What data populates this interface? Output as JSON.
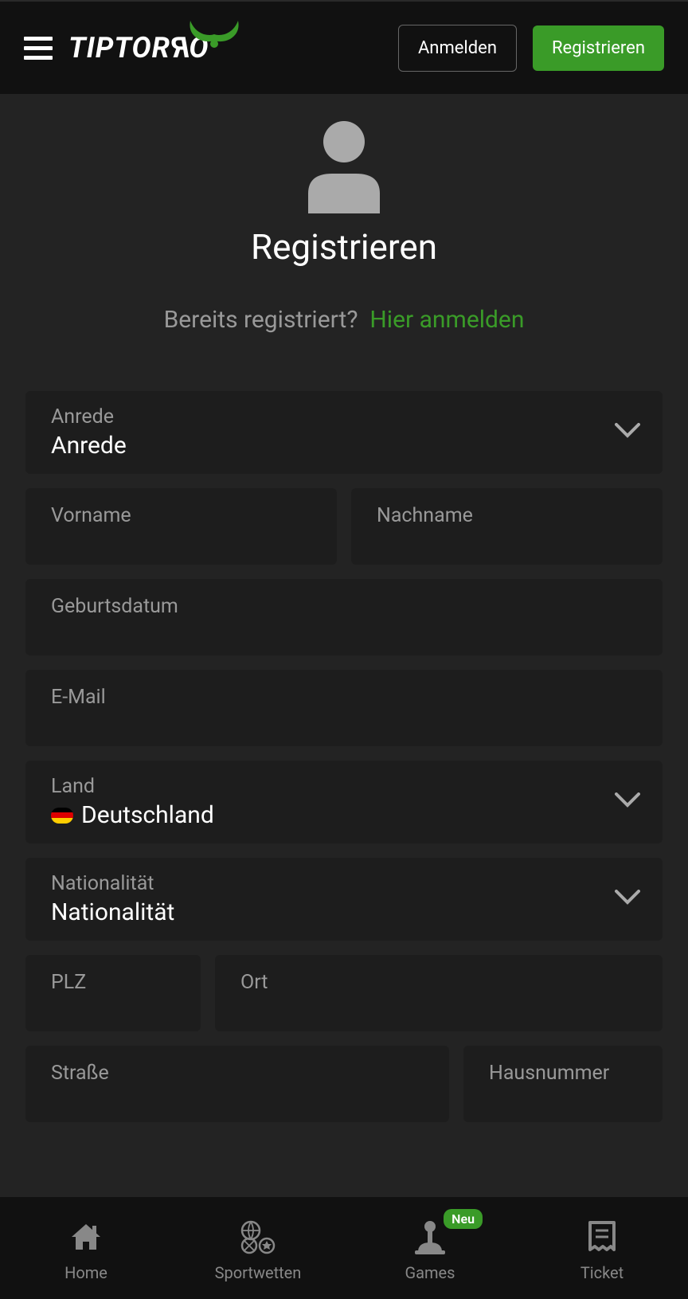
{
  "header": {
    "brand": "TIPTORRO",
    "login": "Anmelden",
    "register": "Registrieren"
  },
  "page": {
    "title": "Registrieren",
    "already_text": "Bereits registriert?",
    "login_link": "Hier anmelden"
  },
  "form": {
    "salutation": {
      "label": "Anrede",
      "value": "Anrede"
    },
    "firstname": {
      "label": "Vorname"
    },
    "lastname": {
      "label": "Nachname"
    },
    "dob": {
      "label": "Geburtsdatum"
    },
    "email": {
      "label": "E-Mail"
    },
    "country": {
      "label": "Land",
      "value": "Deutschland"
    },
    "nationality": {
      "label": "Nationalität",
      "value": "Nationalität"
    },
    "zip": {
      "label": "PLZ"
    },
    "city": {
      "label": "Ort"
    },
    "street": {
      "label": "Straße"
    },
    "housenumber": {
      "label": "Hausnummer"
    }
  },
  "nav": {
    "home": "Home",
    "sports": "Sportwetten",
    "games": "Games",
    "games_badge": "Neu",
    "ticket": "Ticket"
  }
}
